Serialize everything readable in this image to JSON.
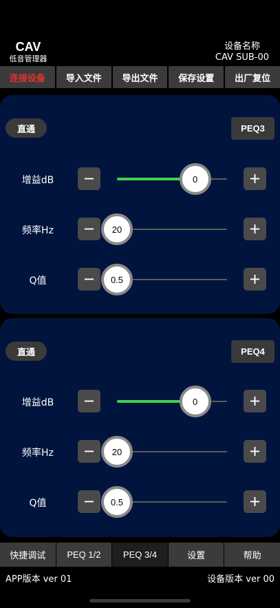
{
  "header": {
    "brand_name": "CAV",
    "brand_sub": "低音管理器",
    "device_label": "设备名称",
    "device_name": "CAV SUB-00"
  },
  "topnav": {
    "connect": "连接设备",
    "import": "导入文件",
    "export": "导出文件",
    "save": "保存设置",
    "reset": "出厂复位"
  },
  "colors": {
    "panel_bg": "#00143d",
    "active_red": "#e0322f",
    "slider_green": "#3fd34f"
  },
  "panels": [
    {
      "bypass_label": "直通",
      "peq_label": "PEQ3",
      "gain": {
        "label": "增益dB",
        "value": "0",
        "position": 0.71
      },
      "freq": {
        "label": "频率Hz",
        "value": "20",
        "position": 0.0
      },
      "q": {
        "label": "Q值",
        "value": "0.5",
        "position": 0.0
      }
    },
    {
      "bypass_label": "直通",
      "peq_label": "PEQ4",
      "gain": {
        "label": "增益dB",
        "value": "0",
        "position": 0.71
      },
      "freq": {
        "label": "频率Hz",
        "value": "20",
        "position": 0.0
      },
      "q": {
        "label": "Q值",
        "value": "0.5",
        "position": 0.0
      }
    }
  ],
  "bottomnav": {
    "quick": "快捷调试",
    "peq12": "PEQ 1/2",
    "peq34": "PEQ 3/4",
    "settings": "设置",
    "help": "帮助"
  },
  "footer": {
    "app_version": "APP版本 ver 01",
    "device_version": "设备版本 ver 00"
  }
}
